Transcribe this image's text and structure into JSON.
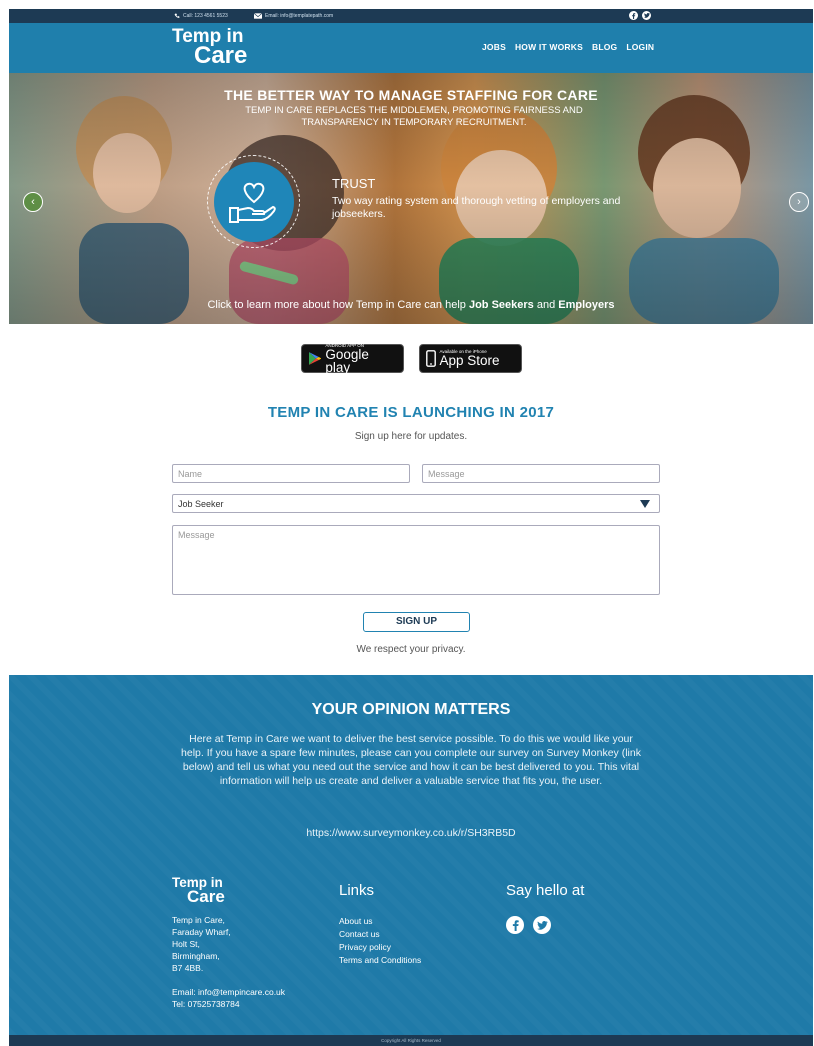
{
  "topbar": {
    "phone": "Call: 123 4561 5523",
    "email": "Email: info@templatepath.com",
    "social_icons": [
      "facebook-icon",
      "twitter-icon"
    ]
  },
  "header": {
    "logo_line1": "Temp in",
    "logo_line2": "Care",
    "nav": [
      "JOBS",
      "HOW IT WORKS",
      "BLOG",
      "LOGIN"
    ]
  },
  "hero": {
    "title": "THE BETTER WAY TO MANAGE STAFFING FOR CARE",
    "subtitle": "TEMP IN CARE REPLACES THE MIDDLEMEN, PROMOTING FAIRNESS AND TRANSPARENCY IN TEMPORARY RECRUITMENT.",
    "slide_title": "TRUST",
    "slide_text": "Two way rating system and thorough vetting of employers and jobseekers.",
    "learn_prefix": "Click to learn more about how Temp in Care can help",
    "learn_seekers": "Job Seekers",
    "learn_and": "and",
    "learn_employers": "Employers",
    "slide_icon": "heart-in-hand-icon",
    "prev_icon": "chevron-left-icon",
    "next_icon": "chevron-right-icon"
  },
  "badges": {
    "google_small": "ANDROID APP ON",
    "google_big": "Google play",
    "apple_small": "Available on the iPhone",
    "apple_big": "App Store"
  },
  "signup": {
    "title": "TEMP IN CARE IS LAUNCHING IN 2017",
    "subtitle": "Sign up here for updates.",
    "name_placeholder": "Name",
    "message_placeholder": "Message",
    "select_value": "Job Seeker",
    "textarea_placeholder": "Message",
    "button": "SIGN UP",
    "privacy": "We respect your privacy."
  },
  "opinion": {
    "title": "YOUR OPINION MATTERS",
    "body": "Here at Temp in Care we want to deliver the best service possible. To do this we would like your help. If you have a spare few minutes, please can you complete our survey on Survey Monkey (link below) and tell us what you need out the service and how it can be best delivered to you. This vital information will help us create and deliver a valuable service that fits you, the user.",
    "url": "https://www.surveymonkey.co.uk/r/SH3RB5D"
  },
  "footer": {
    "logo_line1": "Temp in",
    "logo_line2": "Care",
    "address": [
      "Temp in Care,",
      "Faraday Wharf,",
      "Holt St,",
      "Birmingham,",
      "B7 4BB."
    ],
    "email": "Email: info@tempincare.co.uk",
    "tel": "Tel: 07525738784",
    "links_title": "Links",
    "links": [
      "About us",
      "Contact us",
      "Privacy policy",
      "Terms and Conditions"
    ],
    "hello_title": "Say hello at",
    "copyright": "Copyright",
    "copyright_tail": "All Rights Reserved"
  },
  "colors": {
    "brand_blue": "#1f7fac",
    "navy": "#1d3a54",
    "heading_blue": "#2183b1"
  }
}
